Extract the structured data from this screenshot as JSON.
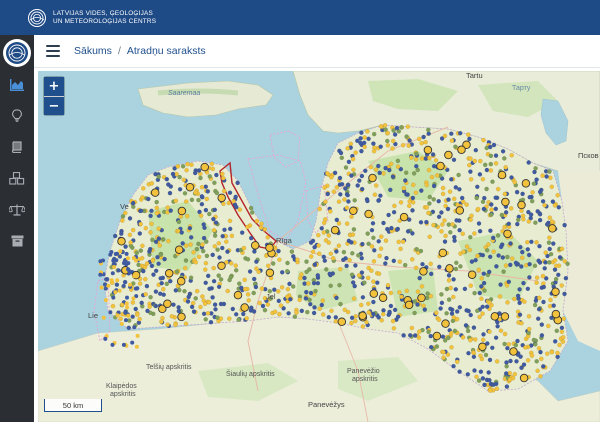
{
  "brand": {
    "line1": "LATVIJAS VIDES, ĢEOLOĢIJAS",
    "line2": "UN METEOROLOĢIJAS CENTRS"
  },
  "header": {
    "breadcrumb_home": "Sākums",
    "breadcrumb_sep": "/",
    "breadcrumb_current": "Atradņu saraksts"
  },
  "sidebar": {
    "items": [
      {
        "icon": "chart-icon"
      },
      {
        "icon": "lightbulb-icon"
      },
      {
        "icon": "book-icon"
      },
      {
        "icon": "cubes-icon"
      },
      {
        "icon": "scales-icon"
      },
      {
        "icon": "archive-icon"
      }
    ]
  },
  "map": {
    "zoom_in": "+",
    "zoom_out": "−",
    "scale_label": "50 km",
    "labels": {
      "saaremaa": "Saaremaa",
      "tartu": "Tartu",
      "tartu_cyr": "Тарту",
      "pskov": "Псков",
      "ventspils": "Ve",
      "liepaja": "Lie",
      "jelgava": "Jel",
      "riga": "Rīga",
      "telsiu": "Telšių apskritis",
      "siauliu": "Šiaulių apskritis",
      "panevezio1": "Panevėžio",
      "panevezio2": "apskritis",
      "klaipedos1": "Klaipėdos",
      "klaipedos2": "apskritis",
      "panevezys": "Panevėžys"
    }
  },
  "colors": {
    "topbar": "#1e4a86",
    "sidebar": "#2b2e33",
    "accent": "#1f4f8c",
    "sea": "#aad3df",
    "land": "#e9ecd8",
    "forest": "#bfe0a8",
    "dot_blue": "#3f5aa0",
    "dot_yellow": "#f2c23c",
    "dot_green": "#7f9f5a"
  }
}
